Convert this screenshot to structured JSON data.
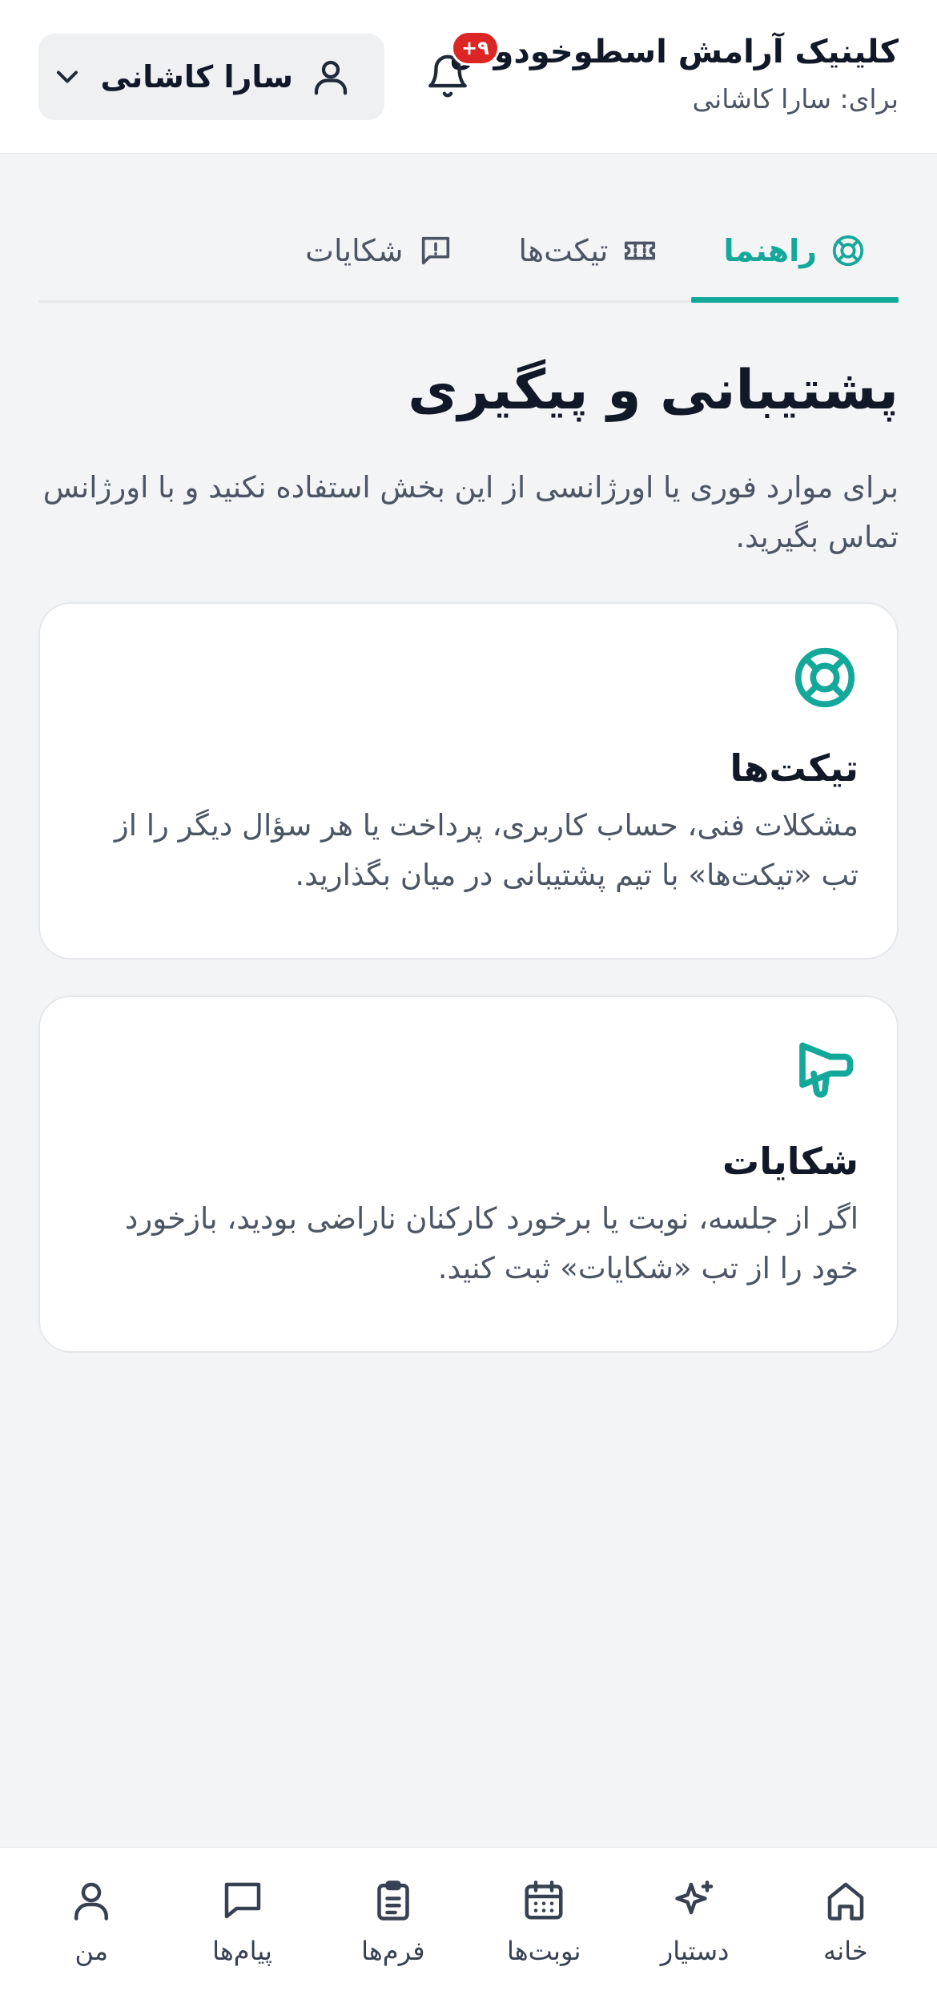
{
  "header": {
    "clinic_name": "کلینیک آرامش اسطوخودوس",
    "for_label": "برای: سارا کاشانی",
    "notification_badge": "۹+",
    "user_name": "سارا کاشانی"
  },
  "tabs": [
    {
      "label": "راهنما",
      "icon": "lifebuoy-icon",
      "active": true
    },
    {
      "label": "تیکت‌ها",
      "icon": "ticket-icon",
      "active": false
    },
    {
      "label": "شکایات",
      "icon": "alert-message-icon",
      "active": false
    }
  ],
  "page": {
    "title": "پشتیبانی و پیگیری",
    "description": "برای موارد فوری یا اورژانسی از این بخش استفاده نکنید و با اورژانس تماس بگیرید."
  },
  "cards": [
    {
      "icon": "lifebuoy-icon",
      "title": "تیکت‌ها",
      "body": "مشکلات فنی، حساب کاربری، پرداخت یا هر سؤال دیگر را از تب «تیکت‌ها» با تیم پشتیبانی در میان بگذارید."
    },
    {
      "icon": "megaphone-icon",
      "title": "شکایات",
      "body": "اگر از جلسه، نوبت یا برخورد کارکنان ناراضی بودید، بازخورد خود را از تب «شکایات» ثبت کنید."
    }
  ],
  "bottom_nav": [
    {
      "label": "خانه",
      "icon": "home-icon"
    },
    {
      "label": "دستیار",
      "icon": "sparkles-icon"
    },
    {
      "label": "نوبت‌ها",
      "icon": "calendar-icon"
    },
    {
      "label": "فرم‌ها",
      "icon": "clipboard-icon"
    },
    {
      "label": "پیام‌ها",
      "icon": "chat-icon"
    },
    {
      "label": "من",
      "icon": "user-icon"
    }
  ],
  "colors": {
    "accent": "#14a89a",
    "badge": "#dc2626",
    "background": "#f3f4f6"
  }
}
